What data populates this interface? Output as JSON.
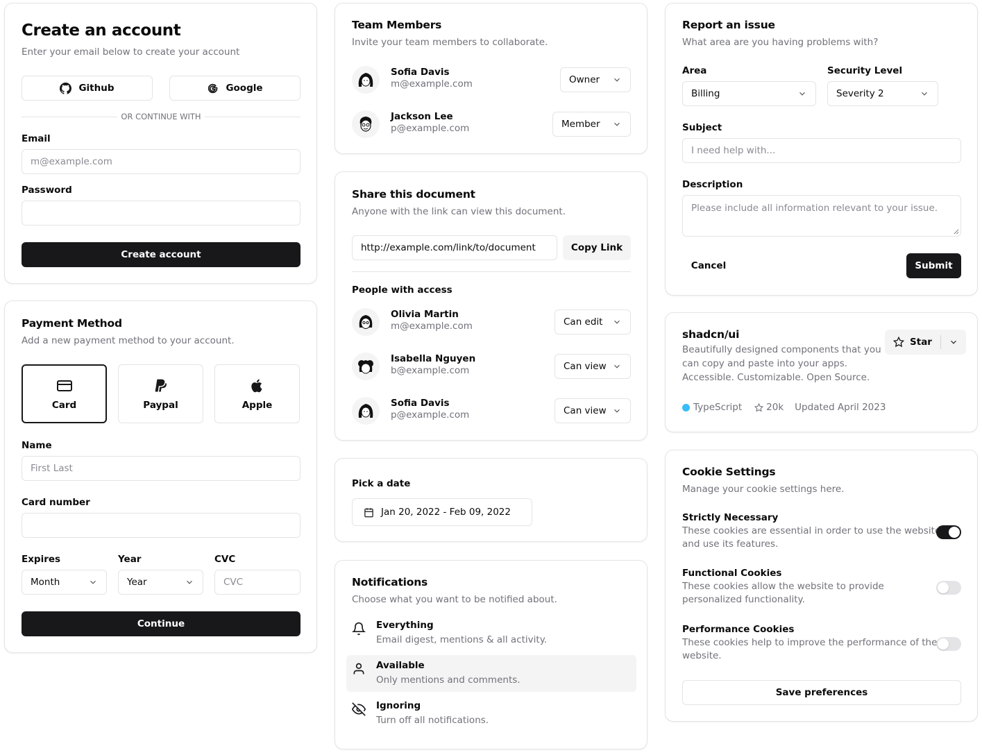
{
  "create_account": {
    "title": "Create an account",
    "subtitle": "Enter your email below to create your account",
    "github": "Github",
    "google": "Google",
    "divider": "OR CONTINUE WITH",
    "email_label": "Email",
    "email_placeholder": "m@example.com",
    "password_label": "Password",
    "submit": "Create account"
  },
  "payment": {
    "title": "Payment Method",
    "subtitle": "Add a new payment method to your account.",
    "options": [
      "Card",
      "Paypal",
      "Apple"
    ],
    "selected": "Card",
    "name_label": "Name",
    "name_placeholder": "First Last",
    "card_label": "Card number",
    "expires_label": "Expires",
    "year_label": "Year",
    "cvc_label": "CVC",
    "month_value": "Month",
    "year_value": "Year",
    "cvc_placeholder": "CVC",
    "submit": "Continue"
  },
  "team": {
    "title": "Team Members",
    "subtitle": "Invite your team members to collaborate.",
    "members": [
      {
        "name": "Sofia Davis",
        "email": "m@example.com",
        "role": "Owner"
      },
      {
        "name": "Jackson Lee",
        "email": "p@example.com",
        "role": "Member"
      }
    ]
  },
  "share": {
    "title": "Share this document",
    "subtitle": "Anyone with the link can view this document.",
    "link": "http://example.com/link/to/document",
    "copy": "Copy Link",
    "people_label": "People with access",
    "people": [
      {
        "name": "Olivia Martin",
        "email": "m@example.com",
        "access": "Can edit"
      },
      {
        "name": "Isabella Nguyen",
        "email": "b@example.com",
        "access": "Can view"
      },
      {
        "name": "Sofia Davis",
        "email": "p@example.com",
        "access": "Can view"
      }
    ]
  },
  "date": {
    "label": "Pick a date",
    "value": "Jan 20, 2022 - Feb 09, 2022"
  },
  "notifications": {
    "title": "Notifications",
    "subtitle": "Choose what you want to be notified about.",
    "items": [
      {
        "title": "Everything",
        "desc": "Email digest, mentions & all activity."
      },
      {
        "title": "Available",
        "desc": "Only mentions and comments."
      },
      {
        "title": "Ignoring",
        "desc": "Turn off all notifications."
      }
    ]
  },
  "report": {
    "title": "Report an issue",
    "subtitle": "What area are you having problems with?",
    "area_label": "Area",
    "area_value": "Billing",
    "security_label": "Security Level",
    "security_value": "Severity 2",
    "subject_label": "Subject",
    "subject_placeholder": "I need help with...",
    "description_label": "Description",
    "description_placeholder": "Please include all information relevant to your issue.",
    "cancel": "Cancel",
    "submit": "Submit"
  },
  "repo": {
    "name": "shadcn/ui",
    "desc_lines": [
      "Beautifully designed components that you",
      "can copy and paste into your apps.",
      "Accessible. Customizable. Open Source."
    ],
    "star": "Star",
    "language": "TypeScript",
    "stars": "20k",
    "updated": "Updated April 2023",
    "language_color": "#38bdf8"
  },
  "cookies": {
    "title": "Cookie Settings",
    "subtitle": "Manage your cookie settings here.",
    "items": [
      {
        "title": "Strictly Necessary",
        "desc1": "These cookies are essential in order to use the website",
        "desc2": "and use its features.",
        "enabled": true
      },
      {
        "title": "Functional Cookies",
        "desc1": "These cookies allow the website to provide",
        "desc2": "personalized functionality.",
        "enabled": false
      },
      {
        "title": "Performance Cookies",
        "desc1": "These cookies help to improve the performance of the",
        "desc2": "website.",
        "enabled": false
      }
    ],
    "save": "Save preferences"
  }
}
